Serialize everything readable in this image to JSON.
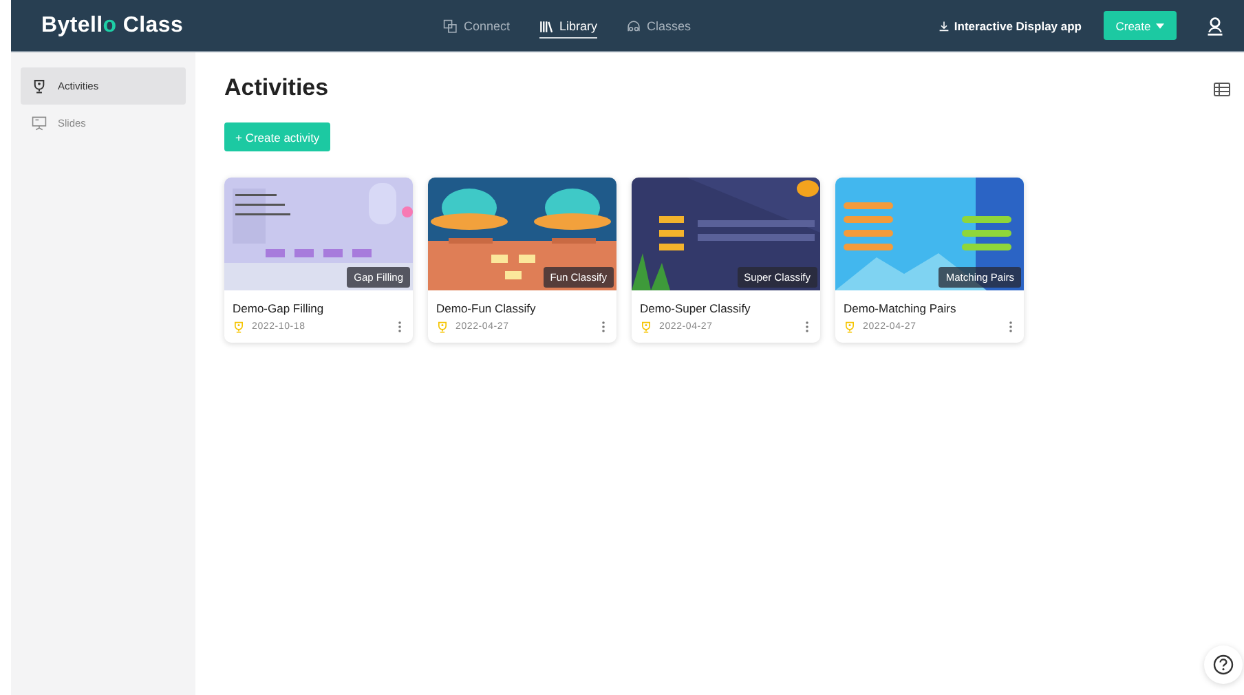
{
  "header": {
    "logo": {
      "main": "Bytell",
      "accent": "o",
      "rest": " Class"
    },
    "nav": [
      {
        "label": "Connect",
        "selected": false
      },
      {
        "label": "Library",
        "selected": true
      },
      {
        "label": "Classes",
        "selected": false
      }
    ],
    "download_link": "Interactive Display app",
    "create_button": "Create"
  },
  "sidebar": {
    "items": [
      {
        "label": "Activities",
        "selected": true
      },
      {
        "label": "Slides",
        "selected": false
      }
    ]
  },
  "main": {
    "title": "Activities",
    "create_button": "+ Create activity",
    "cards": [
      {
        "title": "Demo-Gap Filling",
        "type": "Gap Filling",
        "date": "2022-10-18"
      },
      {
        "title": "Demo-Fun Classify",
        "type": "Fun Classify",
        "date": "2022-04-27"
      },
      {
        "title": "Demo-Super Classify",
        "type": "Super Classify",
        "date": "2022-04-27"
      },
      {
        "title": "Demo-Matching Pairs",
        "type": "Matching Pairs",
        "date": "2022-04-27"
      }
    ]
  }
}
